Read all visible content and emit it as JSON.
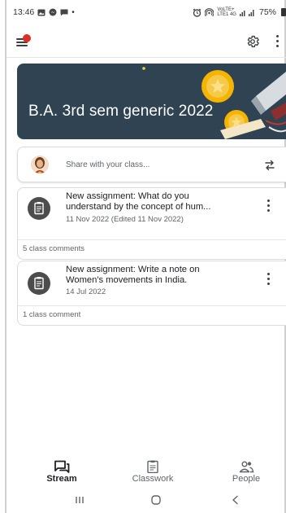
{
  "status_bar": {
    "time": "13:46",
    "left_icons": [
      "gallery-icon",
      "messenger-icon",
      "chat-icon"
    ],
    "dot": "•",
    "volte_top": "VoLTE+",
    "volte_bottom": "LTE1 4G",
    "battery_percent": "75%",
    "right_icons": [
      "alarm-icon",
      "hotspot-icon",
      "signal-icon",
      "battery-icon"
    ]
  },
  "app_bar": {
    "icons": [
      "menu-icon",
      "notification-dot",
      "settings-gear-icon",
      "more-vert-icon"
    ],
    "notification_color": "#d93025"
  },
  "banner": {
    "title": "B.A. 3rd sem generic 2022",
    "background": "#2f4352"
  },
  "share": {
    "placeholder": "Share with your class...",
    "icon": "repost-icon"
  },
  "stream_items": [
    {
      "title_line1": "New assignment: What do you",
      "title_line2": "understand by the concept of hum...",
      "date": "11 Nov 2022 (Edited 11 Nov 2022)",
      "comments": "5 class comments",
      "icon": "assignment-icon"
    },
    {
      "title_line1": "New assignment: Write a note on",
      "title_line2": "Women's movements in India.",
      "date": "14 Jul 2022",
      "comments": "1 class comment",
      "icon": "assignment-icon"
    }
  ],
  "bottom_nav": {
    "items": [
      {
        "label": "Stream",
        "icon": "stream-icon",
        "active": true
      },
      {
        "label": "Classwork",
        "icon": "classwork-icon",
        "active": false
      },
      {
        "label": "People",
        "icon": "people-icon",
        "active": false
      }
    ]
  },
  "system_nav": {
    "icons": [
      "recents-icon",
      "home-icon",
      "back-icon"
    ]
  },
  "colors": {
    "accent": "#d93025",
    "banner": "#2f4352",
    "assignment_circle": "#4d4d4d",
    "text": "#202124",
    "muted": "#5f6368"
  }
}
